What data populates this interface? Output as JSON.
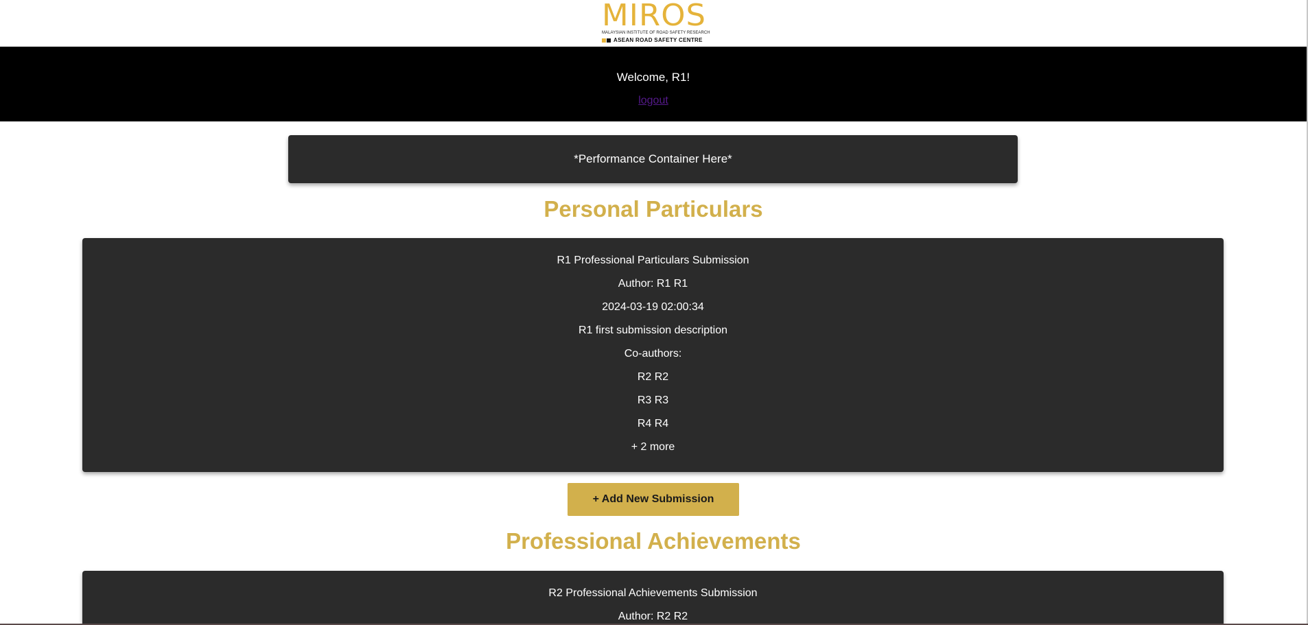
{
  "header": {
    "logo_word": "MIROS",
    "logo_line1": "MALAYSIAN INSTITUTE OF ROAD SAFETY RESEARCH",
    "logo_line2": "ASEAN ROAD SAFETY CENTRE"
  },
  "welcome": {
    "text": "Welcome, R1!",
    "logout_label": "logout"
  },
  "performance": {
    "text": "*Performance Container Here*"
  },
  "personal_particulars": {
    "title": "Personal Particulars",
    "submission": {
      "title": "R1 Professional Particulars Submission",
      "author": "Author: R1 R1",
      "date": "2024-03-19 02:00:34",
      "description": "R1 first submission description",
      "coauthors_label": "Co-authors:",
      "coauthors": [
        "R2 R2",
        "R3 R3",
        "R4 R4"
      ],
      "more": "+ 2 more"
    },
    "add_button_label": "+ Add New Submission"
  },
  "professional_achievements": {
    "title": "Professional Achievements",
    "submission": {
      "title": "R2 Professional Achievements Submission",
      "author": "Author: R2 R2"
    }
  },
  "colors": {
    "brand_gold": "#d2b04c",
    "logo_gold": "#e5b33a",
    "card_bg": "#2b2b2b",
    "bar_bg": "#000000"
  }
}
